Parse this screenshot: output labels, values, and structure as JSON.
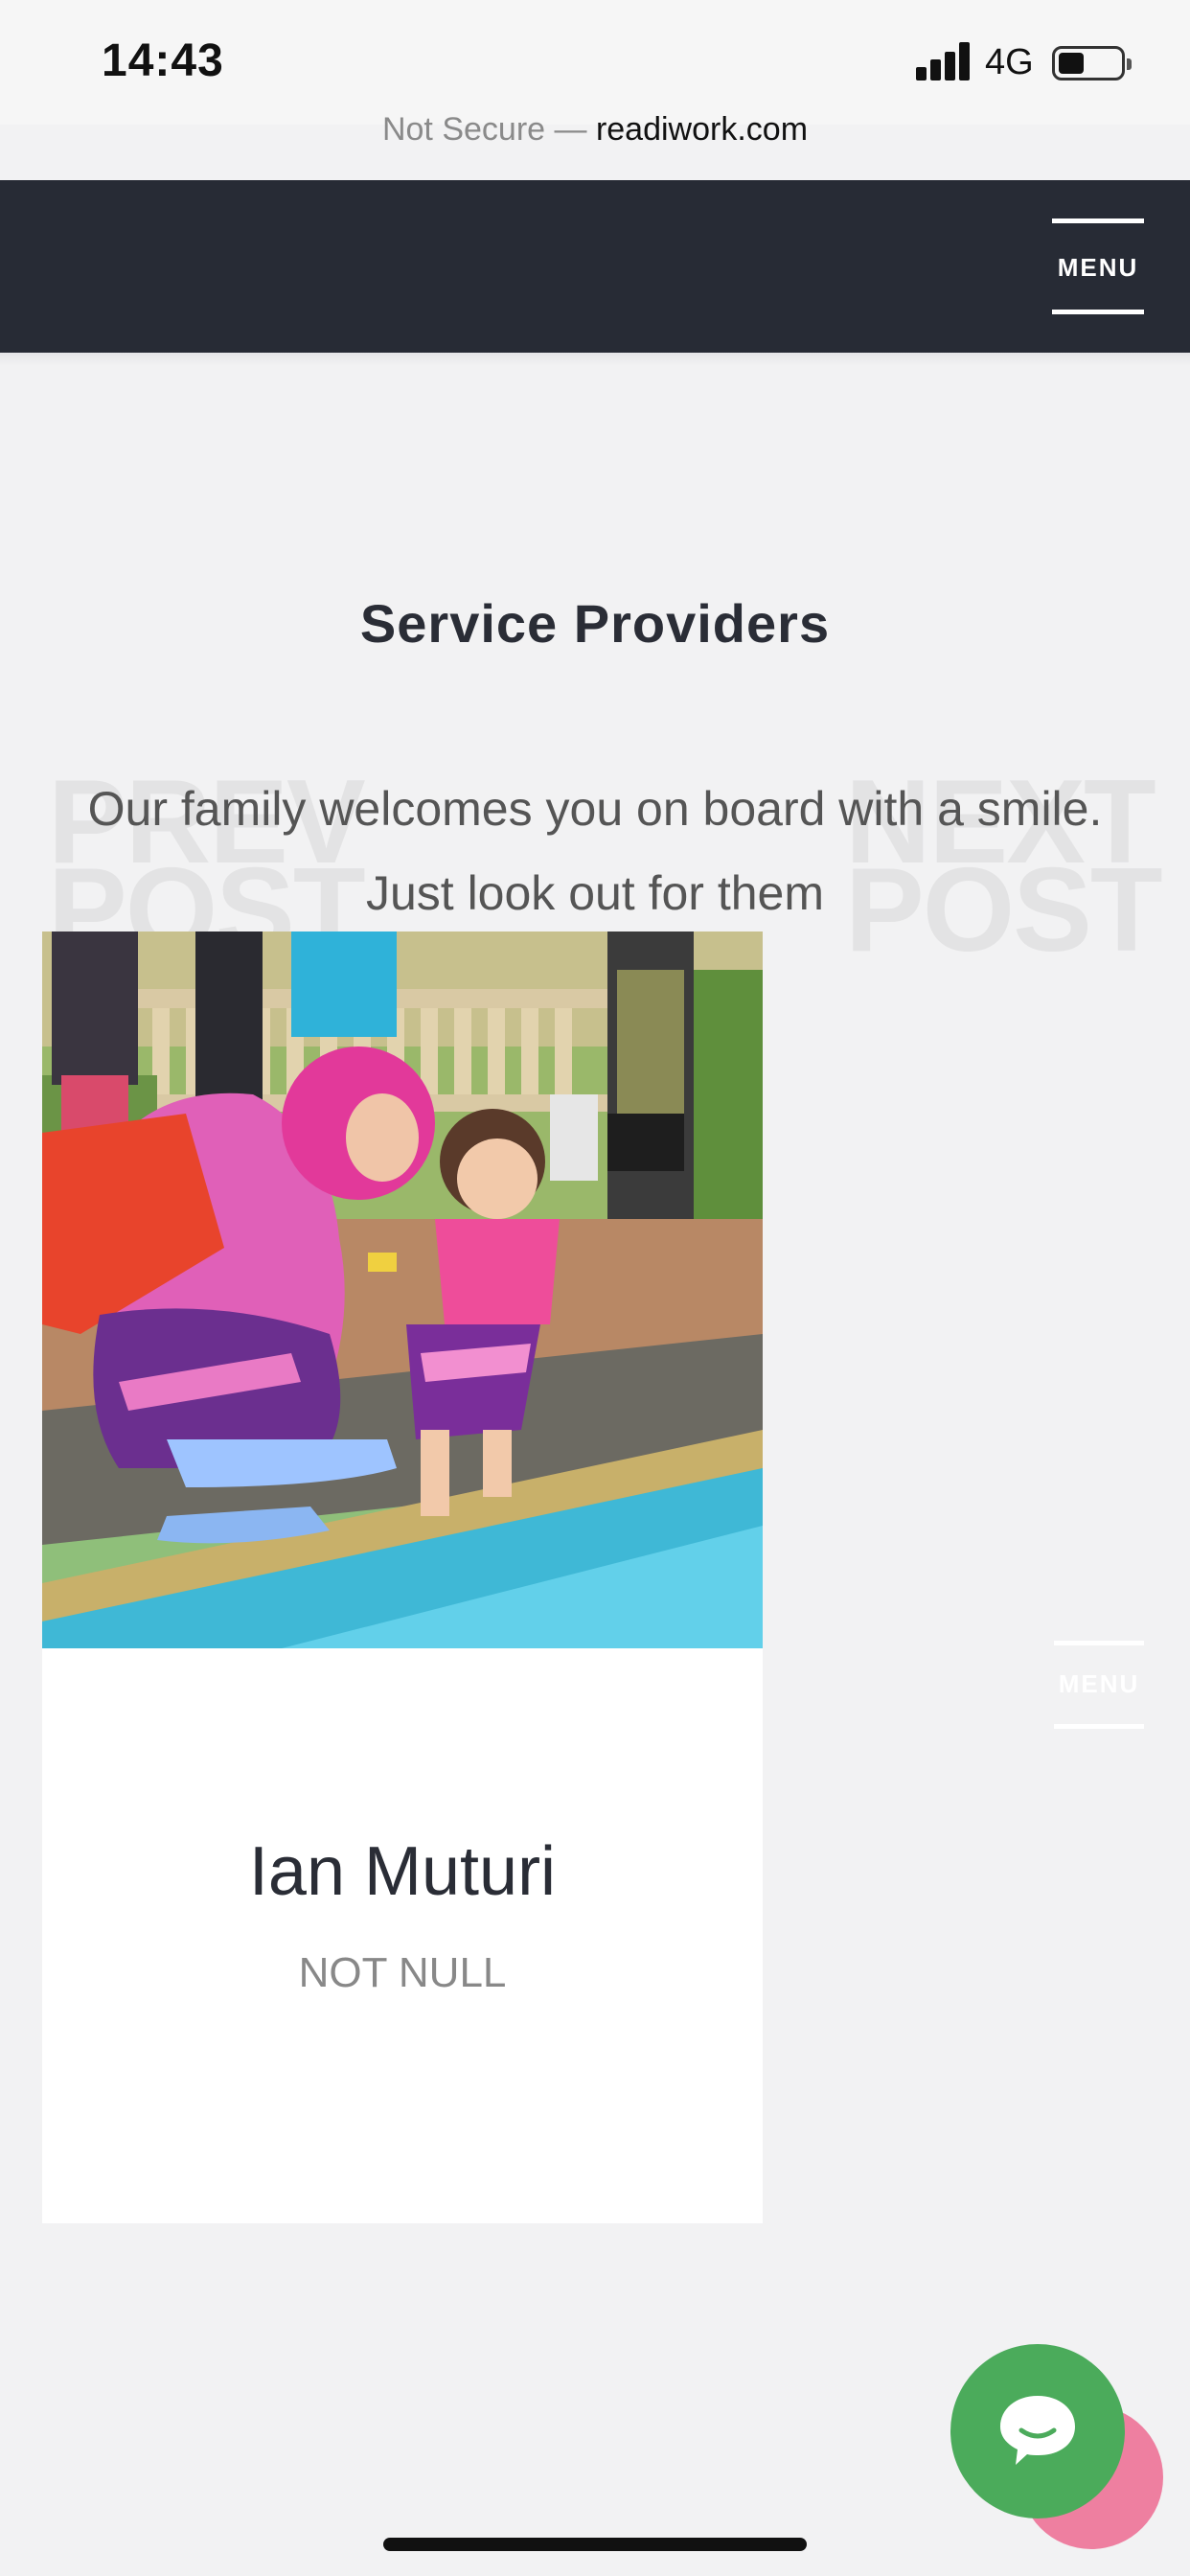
{
  "status_bar": {
    "time": "14:43",
    "network": "4G"
  },
  "browser": {
    "url_prefix": "Not Secure — ",
    "url_domain": "readiwork.com"
  },
  "nav": {
    "menu_label": "MENU"
  },
  "page": {
    "title": "Service Providers",
    "prev_ghost": "PREV POST",
    "next_ghost": "NEXT POST",
    "intro_line1": "Our family welcomes you on board with a smile.",
    "intro_line2": "Just look out for them"
  },
  "provider_card": {
    "name": "Ian Muturi",
    "role": "NOT NULL"
  },
  "faded_menu": {
    "label": "MENU"
  },
  "colors": {
    "nav_bg": "#272b35",
    "chat_green": "#4bab5b",
    "bubble_pink": "#ee7fa0",
    "page_bg": "#f2f2f3"
  },
  "icons": {
    "chat": "chat-bubble-icon",
    "menu": "hamburger-icon"
  }
}
